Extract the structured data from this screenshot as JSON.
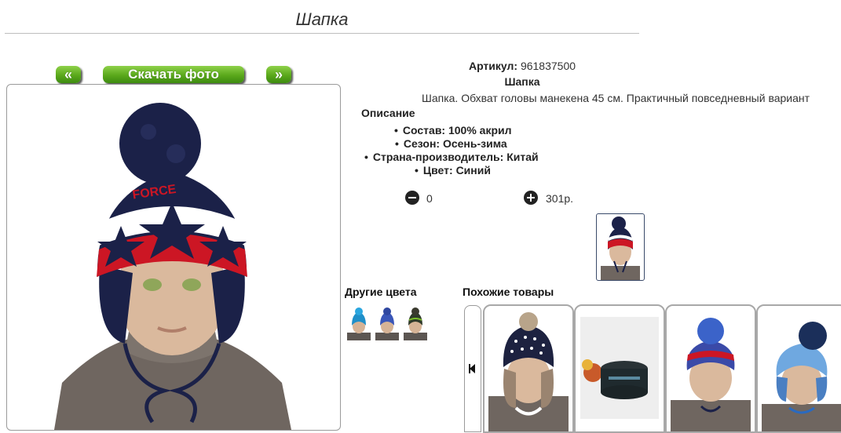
{
  "page_title": "Шапка",
  "nav": {
    "prev": "«",
    "download": "Скачать фото",
    "next": "»"
  },
  "product": {
    "article_label": "Артикул:",
    "article_value": "961837500",
    "name": "Шапка",
    "summary": "Шапка. Обхват головы манекена 45 см. Практичный повседневный вариант",
    "description_title": "Описание",
    "properties": [
      "Состав: 100% акрил",
      "Сезон: Осень-зима",
      "Страна-производитель: Китай",
      "Цвет: Синий"
    ],
    "quantity": "0",
    "price": "301р.",
    "hat_print": "FORCE"
  },
  "other_colors_title": "Другие цвета",
  "similar_title": "Похожие товары",
  "colors": {
    "navy": "#1b2148",
    "red": "#cc1624",
    "white": "#ffffff",
    "skin": "#d9b79a",
    "green": "#5aa81b"
  }
}
